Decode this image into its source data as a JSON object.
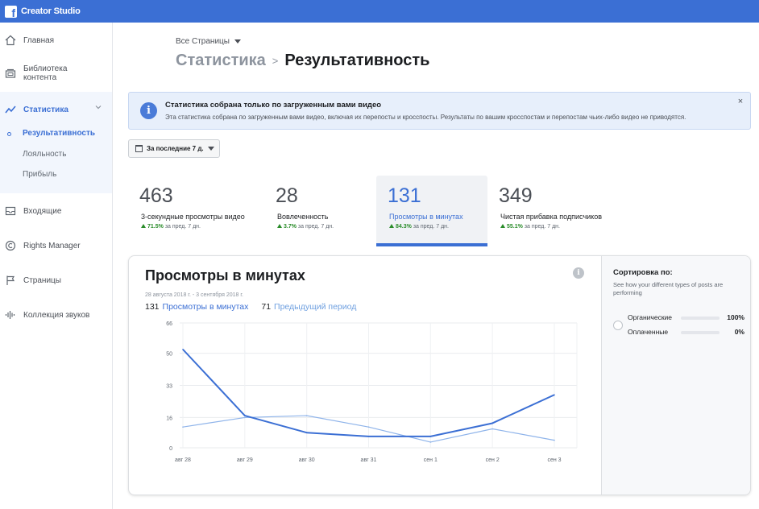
{
  "app": {
    "title": "Creator Studio",
    "logo_letter": "f"
  },
  "sidebar": {
    "items": [
      {
        "label": "Главная",
        "icon": "home-icon"
      },
      {
        "label": "Библиотека контента",
        "icon": "library-icon"
      },
      {
        "label": "Статистика",
        "icon": "insights-icon"
      },
      {
        "label": "Входящие",
        "icon": "inbox-icon"
      },
      {
        "label": "Rights Manager",
        "icon": "copyright-icon"
      },
      {
        "label": "Страницы",
        "icon": "flag-icon"
      },
      {
        "label": "Коллекция звуков",
        "icon": "sound-icon"
      }
    ],
    "sub_items": [
      {
        "label": "Результативность"
      },
      {
        "label": "Лояльность"
      },
      {
        "label": "Прибыль"
      }
    ]
  },
  "header": {
    "pages_select": "Все Страницы",
    "breadcrumb_parent": "Статистика",
    "breadcrumb_separator": ">",
    "breadcrumb_current": "Результативность"
  },
  "banner": {
    "title": "Статистика собрана только по загруженным вами видео",
    "body": "Эта статистика собрана по загруженным вами видео, включая их перепосты и кросспосты. Результаты по вашим кросспостам и перепостам чьих-либо видео не приводятся.",
    "close": "×",
    "info_glyph": "i"
  },
  "period": {
    "label": "За последние 7 д."
  },
  "metrics": [
    {
      "value": "463",
      "label": "3-секундные просмотры видео",
      "delta": "71.5%",
      "delta_suffix": "за пред. 7 дн."
    },
    {
      "value": "28",
      "label": "Вовлеченность",
      "delta": "3.7%",
      "delta_suffix": "за пред. 7 дн."
    },
    {
      "value": "131",
      "label": "Просмотры в минутах",
      "delta": "84.3%",
      "delta_suffix": "за пред. 7 дн."
    },
    {
      "value": "349",
      "label": "Чистая прибавка подписчиков",
      "delta": "55.1%",
      "delta_suffix": "за пред. 7 дн."
    }
  ],
  "chart_panel": {
    "title": "Просмотры в минутах",
    "date_range": "28 августа 2018 г. - 3 сентября 2018 г.",
    "legend_main_value": "131",
    "legend_main_label": "Просмотры в минутах",
    "legend_prev_value": "71",
    "legend_prev_label": "Предыдущий период",
    "info_glyph": "i"
  },
  "chart_data": {
    "type": "line",
    "categories": [
      "авг 28",
      "авг 29",
      "авг 30",
      "авг 31",
      "сен 1",
      "сен 2",
      "сен 3"
    ],
    "series": [
      {
        "name": "Просмотры в минутах",
        "values": [
          52,
          17,
          8,
          6,
          6,
          13,
          28
        ],
        "color": "#3b6fd4"
      },
      {
        "name": "Предыдущий период",
        "values": [
          11,
          16,
          17,
          11,
          3,
          10,
          4
        ],
        "color": "#8fb4ea"
      }
    ],
    "yticks": [
      "66",
      "50",
      "33",
      "16",
      "0"
    ],
    "ylim": [
      0,
      66
    ],
    "grid": true
  },
  "sort_panel": {
    "title": "Сортировка по:",
    "subtitle": "See how your different types of posts are performing",
    "rows": [
      {
        "label": "Органические",
        "value": "100%",
        "fraction": 1.0
      },
      {
        "label": "Оплаченные",
        "value": "0%",
        "fraction": 0.0
      }
    ]
  },
  "colors": {
    "brand": "#3b6fd4",
    "positive": "#2a8c2a",
    "prev_series": "#8fb4ea"
  }
}
